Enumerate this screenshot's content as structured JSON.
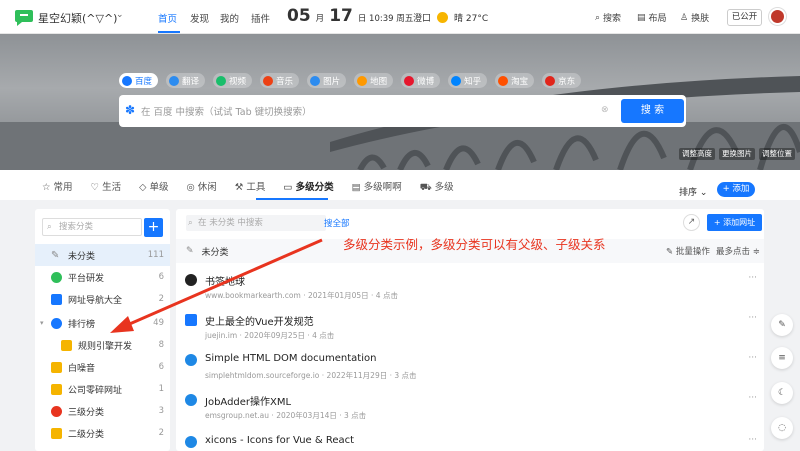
{
  "header": {
    "site_name": "星空幻颖(^▽^)",
    "nav": [
      "首页",
      "发现",
      "我的",
      "插件"
    ],
    "date_month": "05",
    "date_month_unit": "月",
    "date_day": "17",
    "date_rest": "日 10:39 周五",
    "weather_city": "澄口",
    "weather_text": "晴 27°C",
    "tools": [
      "搜索",
      "布局",
      "换肤"
    ],
    "public_label": "已公开"
  },
  "banner": {
    "engines": [
      "百度",
      "翻译",
      "视频",
      "音乐",
      "图片",
      "地图",
      "微博",
      "知乎",
      "淘宝",
      "京东"
    ],
    "search_placeholder": "在 百度 中搜索（试试 Tab 键切换搜索）",
    "search_button": "搜 索",
    "bg_buttons": [
      "调整高度",
      "更换图片",
      "调整位置"
    ]
  },
  "categories": {
    "tabs": [
      "常用",
      "生活",
      "单级",
      "休闲",
      "工具",
      "多级分类",
      "多级啊啊",
      "多级"
    ],
    "active": "多级分类",
    "sort_label": "排序",
    "add_label": "+ 添加"
  },
  "sidebar": {
    "search_placeholder": "搜索分类",
    "items": [
      {
        "label": "未分类",
        "count": "111"
      },
      {
        "label": "平台研发",
        "count": "6"
      },
      {
        "label": "网址导航大全",
        "count": "2"
      },
      {
        "label": "排行榜",
        "count": "49"
      },
      {
        "label": "规则引擎开发",
        "count": "8"
      },
      {
        "label": "白噪音",
        "count": "6"
      },
      {
        "label": "公司零碎网址",
        "count": "1"
      },
      {
        "label": "三级分类",
        "count": "3"
      },
      {
        "label": "二级分类",
        "count": "2"
      }
    ]
  },
  "main": {
    "search_placeholder": "在 未分类 中搜索",
    "search_all": "搜全部",
    "add_site": "+ 添加网址",
    "section_title": "未分类",
    "batch_label": "批量操作",
    "sort_label": "最多点击 ≑",
    "items": [
      {
        "title": "书签地球",
        "meta": "www.bookmarkearth.com · 2021年01月05日 · 4 点击"
      },
      {
        "title": "史上最全的Vue开发规范",
        "meta": "juejin.im · 2020年09月25日 · 4 点击"
      },
      {
        "title": "Simple HTML DOM documentation",
        "meta": "simplehtmldom.sourceforge.io · 2022年11月29日 · 3 点击"
      },
      {
        "title": "JobAdder操作XML",
        "meta": "emsgroup.net.au · 2020年03月14日 · 3 点击"
      },
      {
        "title": "xicons - Icons for Vue & React",
        "meta": ""
      }
    ]
  },
  "annotation": "多级分类示例，多级分类可以有父级、子级关系",
  "colors": {
    "accent": "#1677ff",
    "annotation": "#e8341f"
  }
}
